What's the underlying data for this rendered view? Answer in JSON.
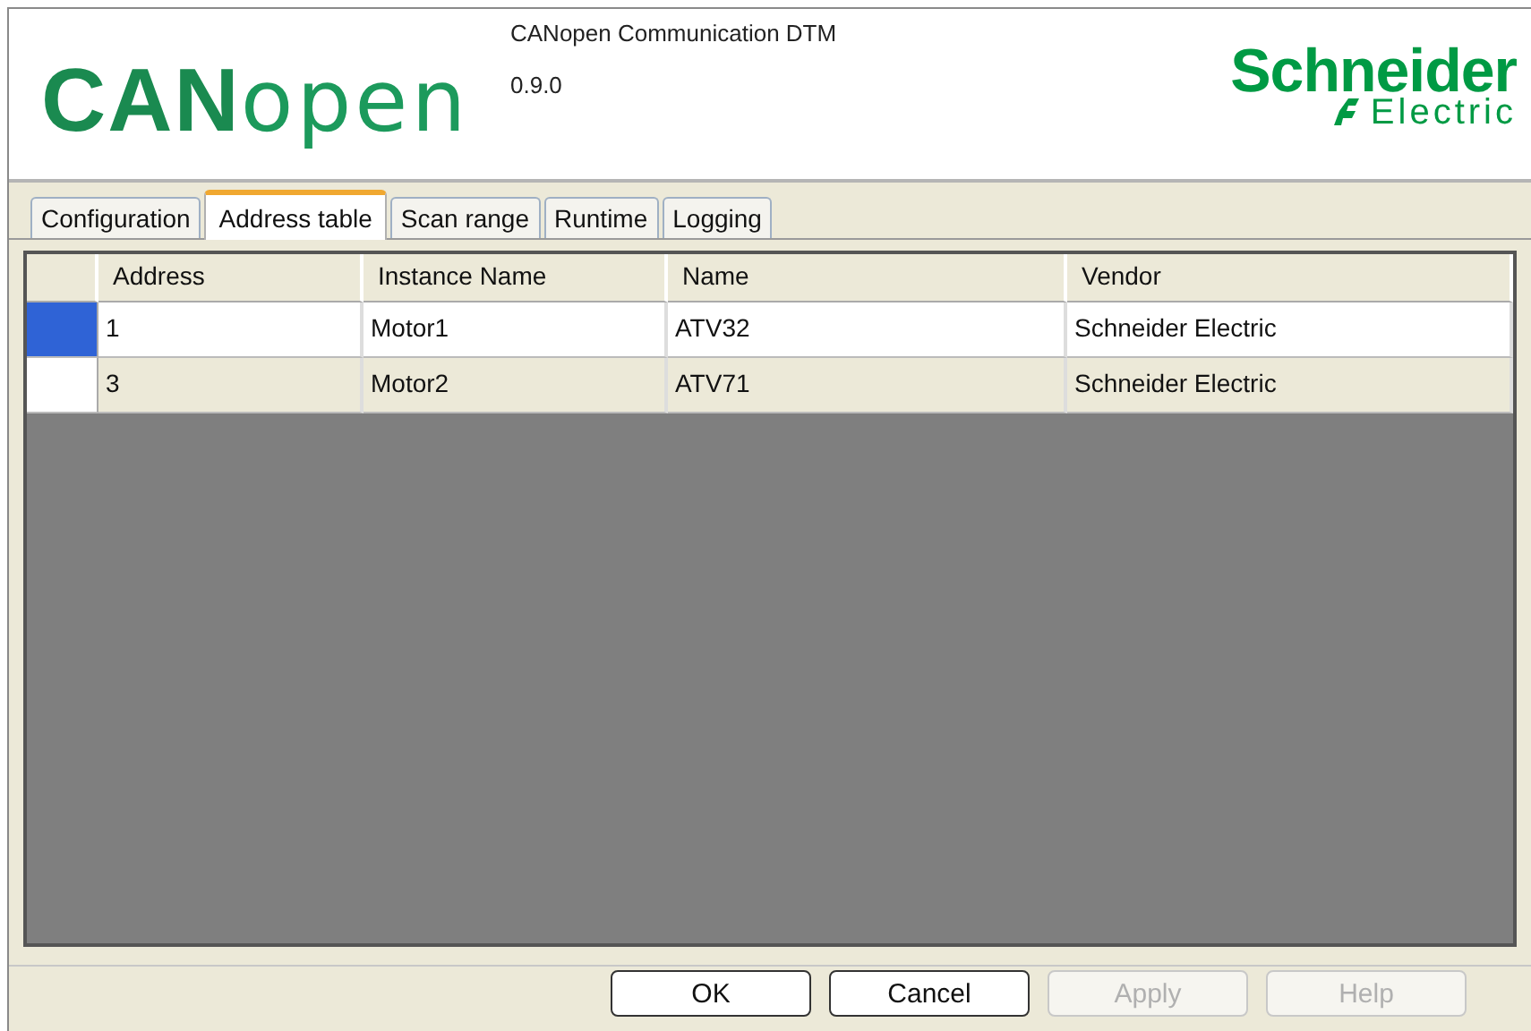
{
  "header": {
    "product_logo": {
      "bold_part": "CAN",
      "light_part": "open"
    },
    "title": "CANopen Communication DTM",
    "version": "0.9.0",
    "brand_logo": {
      "name": "Schneider",
      "subtitle": "Electric"
    }
  },
  "tabs": [
    {
      "label": "Configuration",
      "selected": false
    },
    {
      "label": "Address table",
      "selected": true
    },
    {
      "label": "Scan range",
      "selected": false
    },
    {
      "label": "Runtime",
      "selected": false
    },
    {
      "label": "Logging",
      "selected": false
    }
  ],
  "table": {
    "columns": [
      "Address",
      "Instance Name",
      "Name",
      "Vendor"
    ],
    "rows": [
      {
        "cells": [
          "1",
          "Motor1",
          "ATV32",
          "Schneider Electric"
        ],
        "selected": true
      },
      {
        "cells": [
          "3",
          "Motor2",
          "ATV71",
          "Schneider Electric"
        ],
        "selected": false
      }
    ]
  },
  "buttons": [
    {
      "label": "OK",
      "disabled": false
    },
    {
      "label": "Cancel",
      "disabled": false
    },
    {
      "label": "Apply",
      "disabled": true
    },
    {
      "label": "Help",
      "disabled": true
    }
  ]
}
